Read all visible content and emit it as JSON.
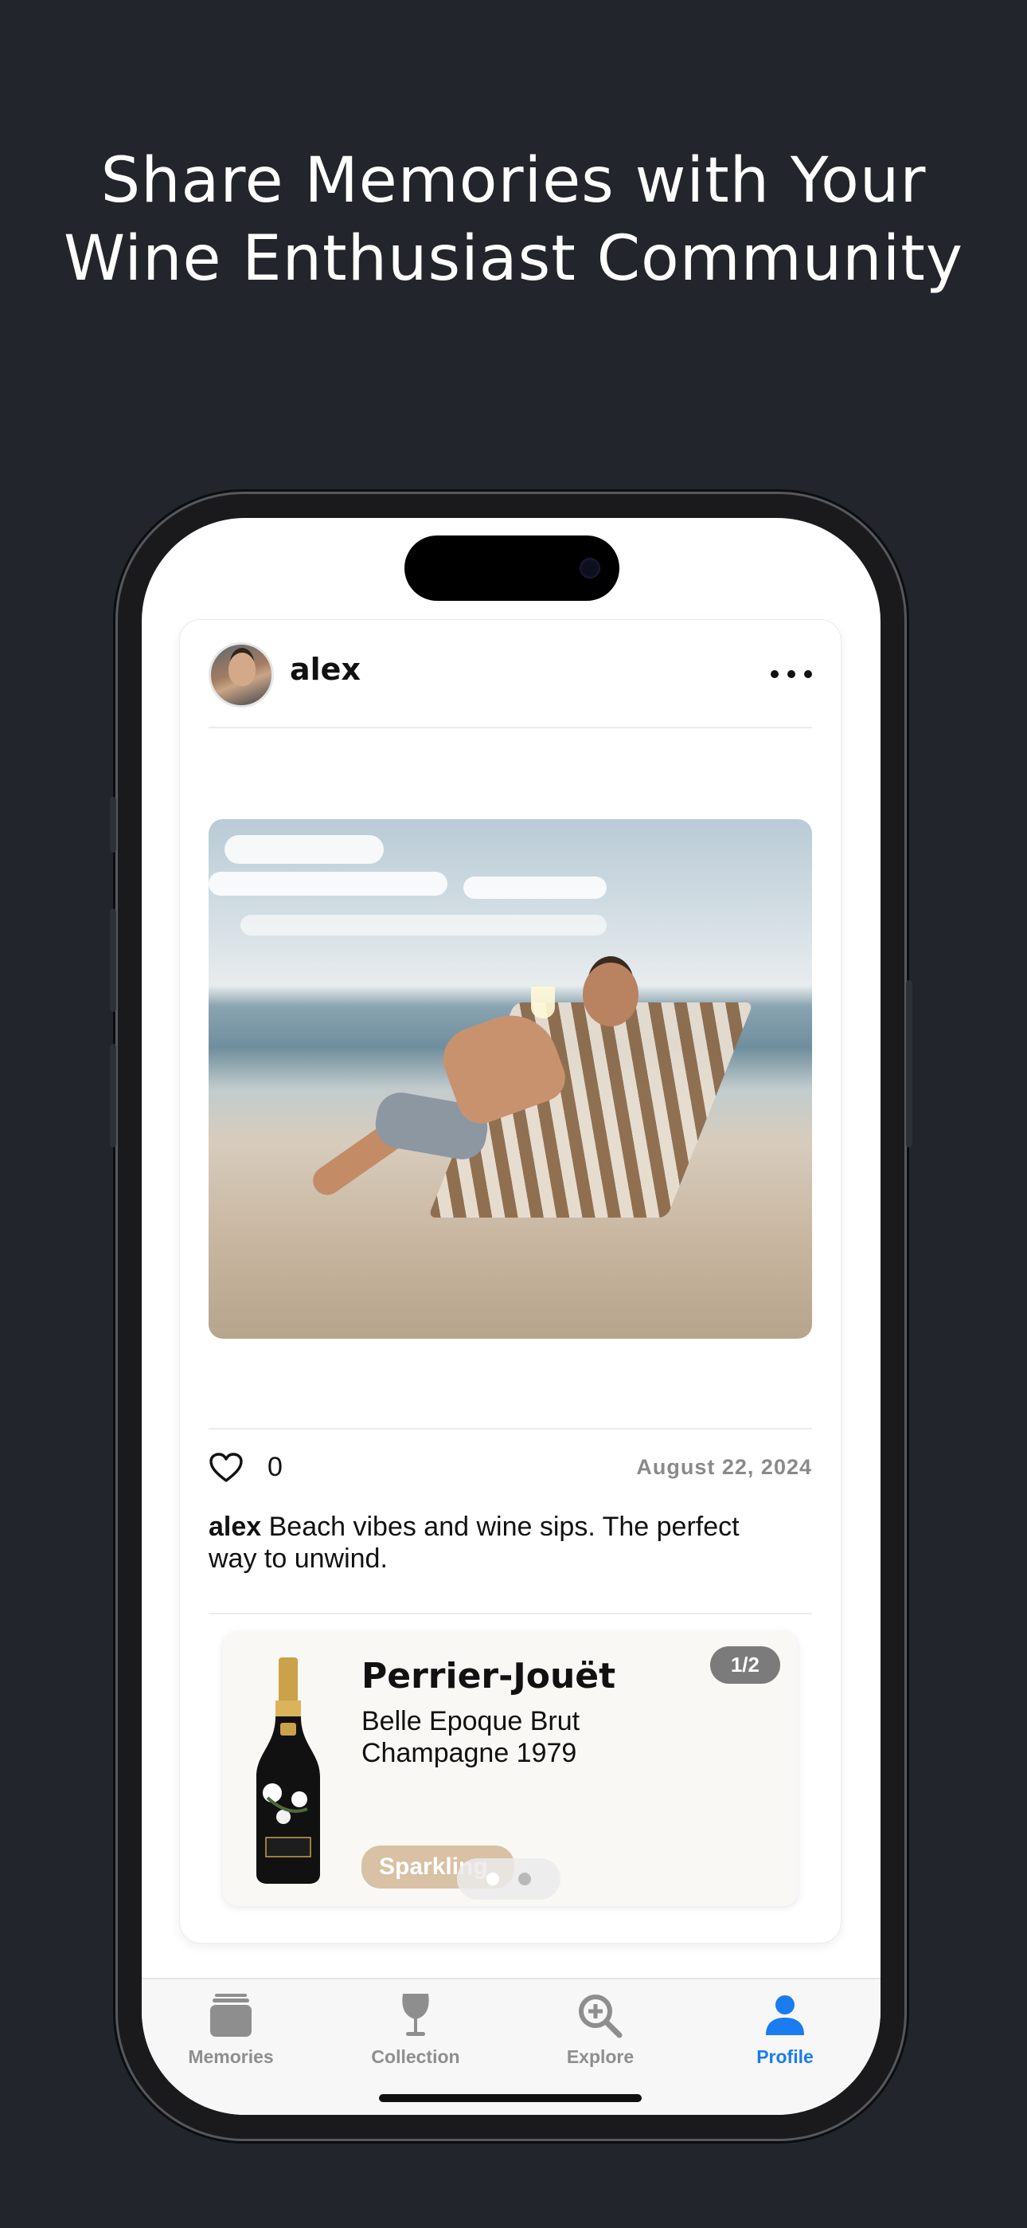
{
  "headline": {
    "line1": "Share Memories with Your",
    "line2": "Wine Enthusiast Community"
  },
  "post": {
    "username": "alex",
    "likes": "0",
    "date": "August 22, 2024",
    "caption_user": "alex",
    "caption_text": " Beach vibes and wine sips. The perfect way to unwind."
  },
  "wine": {
    "producer": "Perrier-Jouët",
    "name": "Belle Epoque Brut Champagne 1979",
    "page": "1/2",
    "type": "Sparkling",
    "chip_color": "#d8c1a4",
    "pager_pages": 2,
    "pager_current": 1
  },
  "tabs": [
    {
      "label": "Memories",
      "icon": "memories-stack-icon"
    },
    {
      "label": "Collection",
      "icon": "wine-glass-icon"
    },
    {
      "label": "Explore",
      "icon": "magnify-plus-icon"
    },
    {
      "label": "Profile",
      "icon": "person-icon",
      "active": true
    }
  ],
  "colors": {
    "background": "#22252b",
    "accent": "#1a7cf0",
    "tab_inactive": "#8e8e8e"
  }
}
